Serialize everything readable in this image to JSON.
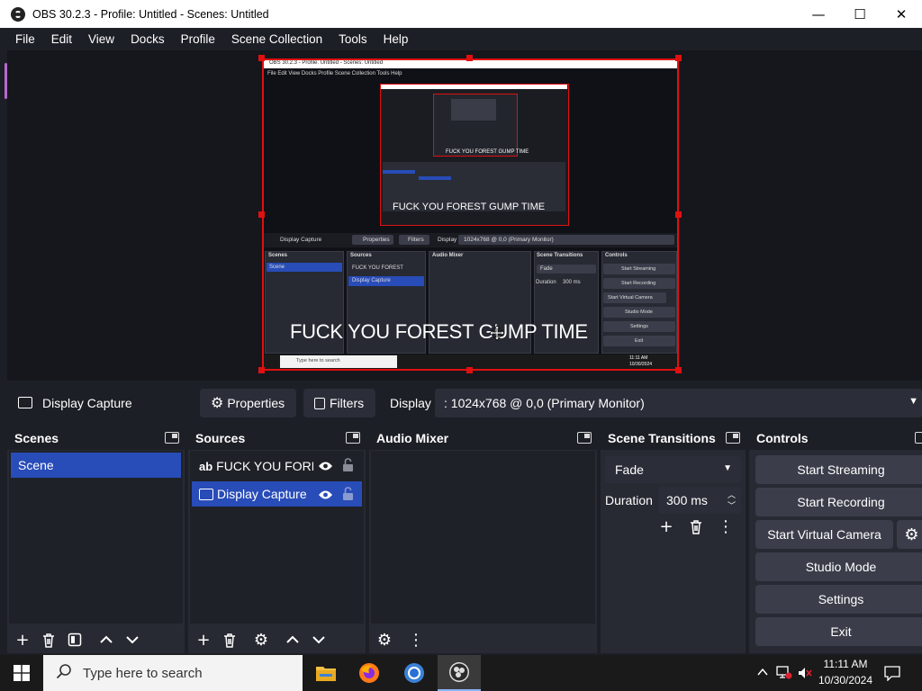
{
  "window": {
    "title": "OBS 30.2.3 - Profile: Untitled - Scenes: Untitled",
    "minimize": "—",
    "maximize": "☐",
    "close": "✕"
  },
  "menu": [
    "File",
    "Edit",
    "View",
    "Docks",
    "Profile",
    "Scene Collection",
    "Tools",
    "Help"
  ],
  "preview": {
    "overlay_text": "FUCK YOU FOREST GUMP TIME",
    "mini": {
      "title": "OBS 30.2.3 - Profile: Untitled - Scenes: Untitled",
      "menu": "File   Edit   View   Docks   Profile   Scene Collection   Tools   Help",
      "source_name": "Display Capture",
      "properties": "Properties",
      "filters": "Filters",
      "display_label": "Display",
      "display_value": "1024x768 @ 0,0 (Primary Monitor)",
      "scenes_header": "Scenes",
      "sources_header": "Sources",
      "mixer_header": "Audio Mixer",
      "transitions_header": "Scene Transitions",
      "controls_header": "Controls",
      "scene_item": "Scene",
      "source_text": "FUCK YOU FOREST",
      "source_capture": "Display Capture",
      "fade": "Fade",
      "duration": "Duration",
      "duration_val": "300 ms",
      "ctrl": [
        "Start Streaming",
        "Start Recording",
        "Start Virtual Camera",
        "Studio Mode",
        "Settings",
        "Exit"
      ],
      "search": "Type here to search",
      "time": "11:11 AM",
      "date": "10/30/2024",
      "inner_text": "FUCK YOU FOREST GUMP TIME",
      "inner_small": "FUCK YOU FOREST GUMP TIME"
    }
  },
  "source_toolbar": {
    "source_name": "Display Capture",
    "properties": "Properties",
    "filters": "Filters",
    "display_label": "Display",
    "display_value": ": 1024x768 @ 0,0 (Primary Monitor)"
  },
  "docks": {
    "scenes": {
      "title": "Scenes",
      "items": [
        "Scene"
      ]
    },
    "sources": {
      "title": "Sources",
      "items": [
        {
          "type": "ab",
          "label": "FUCK YOU FOREST"
        },
        {
          "type": "monitor",
          "label": "Display Capture"
        }
      ]
    },
    "mixer": {
      "title": "Audio Mixer"
    },
    "transitions": {
      "title": "Scene Transitions",
      "transition": "Fade",
      "duration_label": "Duration",
      "duration_value": "300 ms"
    },
    "controls": {
      "title": "Controls",
      "buttons": [
        "Start Streaming",
        "Start Recording",
        "Start Virtual Camera",
        "Studio Mode",
        "Settings",
        "Exit"
      ]
    }
  },
  "taskbar": {
    "search_placeholder": "Type here to search",
    "time": "11:11 AM",
    "date": "10/30/2024"
  },
  "colors": {
    "accent": "#284cb8",
    "selection_border": "#e01010"
  }
}
